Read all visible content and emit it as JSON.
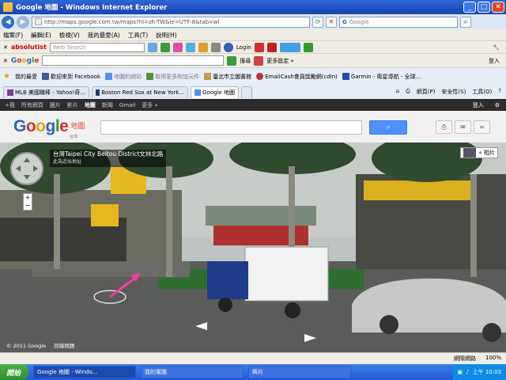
{
  "window": {
    "title": "Google 地圖 - Windows Internet Explorer"
  },
  "address_bar": {
    "url": "http://maps.google.com.tw/maps?hl=zh-TW&ie=UTF-8&tab=wl",
    "search_placeholder": "Google"
  },
  "menu": [
    "檔案(F)",
    "編輯(E)",
    "檢視(V)",
    "我的最愛(A)",
    "工具(T)",
    "說明(H)"
  ],
  "toolbar1": {
    "brand": "absolutist",
    "search_placeholder": "Web Search",
    "login": "Login"
  },
  "toolbar2": {
    "logo": "Google",
    "search_label": "搜尋",
    "more": "更多設定 »",
    "signin": "登入"
  },
  "favorites": {
    "label": "我的最愛",
    "items": [
      "歡迎來到 Facebook",
      "地圖的網站",
      "取得更多附加元件",
      "臺北市立圖書館",
      "EmailCash會員獎勵網(cdin)",
      "Garmin - 衛星導航 - 全球..."
    ]
  },
  "tabs": [
    {
      "label": "MLB 美國職棒 - Yahoo!奇..."
    },
    {
      "label": "Boston Red Sox at New York..."
    },
    {
      "label": "Google 地圖"
    }
  ],
  "tab_tools": [
    "網頁(P)",
    "安全性(S)",
    "工具(O)"
  ],
  "google_bar": {
    "items": [
      "+我",
      "所有網頁",
      "圖片",
      "影片",
      "地圖",
      "新聞",
      "Gmail",
      "更多 »"
    ],
    "current": "地圖",
    "signin": "登入"
  },
  "maps_header": {
    "logo": "Google",
    "product": "地圖",
    "region": "台灣"
  },
  "streetview": {
    "address": "台灣Taipei City Beitou District文林北路",
    "address_sub": "此為近似地址",
    "photos_label": "« 相片",
    "copyright": "© 2011 Google",
    "report": "回報問題"
  },
  "status": {
    "zone": "網際網路",
    "zoom": "100%"
  },
  "taskbar": {
    "start": "開始",
    "tasks": [
      "Google 地圖 - Windo...",
      "我的電腦",
      "照片"
    ],
    "clock": "上午 10:03"
  },
  "colors": {
    "accent": "#4d90fe",
    "ie_title": "#2d68d6",
    "google_bar": "#2d2d2d"
  }
}
